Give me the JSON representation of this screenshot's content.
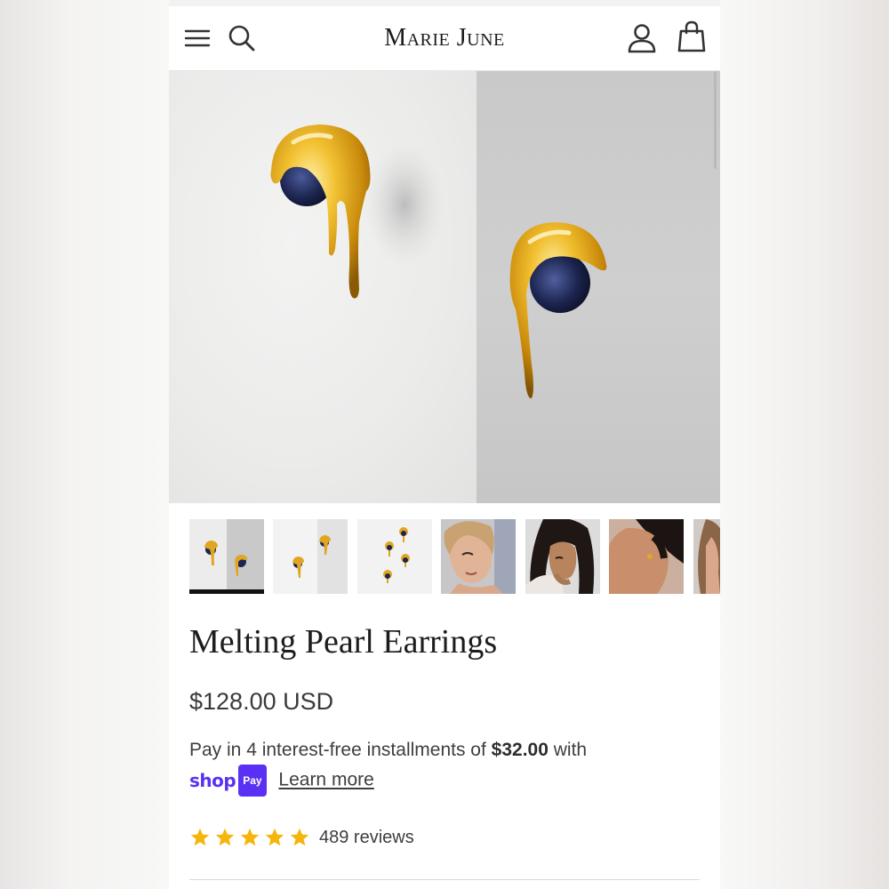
{
  "header": {
    "brand": "Marie June",
    "icons": [
      "menu-icon",
      "search-icon",
      "account-icon",
      "bag-icon"
    ]
  },
  "gallery": {
    "thumbnails": [
      {
        "name": "thumb-earrings-pair",
        "active": true
      },
      {
        "name": "thumb-earrings-white",
        "active": false
      },
      {
        "name": "thumb-earrings-group",
        "active": false
      },
      {
        "name": "thumb-model-1",
        "active": false
      },
      {
        "name": "thumb-model-2",
        "active": false
      },
      {
        "name": "thumb-model-3",
        "active": false
      },
      {
        "name": "thumb-model-4",
        "active": false
      }
    ]
  },
  "product": {
    "title": "Melting Pearl Earrings",
    "price": "$128.00 USD",
    "installment_prefix": "Pay in 4 interest-free installments of",
    "installment_amount": "$32.00",
    "installment_suffix": "with",
    "shop_word": "shop",
    "pay_word": "Pay",
    "learn_more": "Learn more",
    "rating_stars": 5,
    "reviews": "489 reviews"
  },
  "colors": {
    "gold": "#d9a21c",
    "pearl": "#1d2550",
    "shop_pay": "#5a31f4",
    "star": "#f5b50a"
  }
}
